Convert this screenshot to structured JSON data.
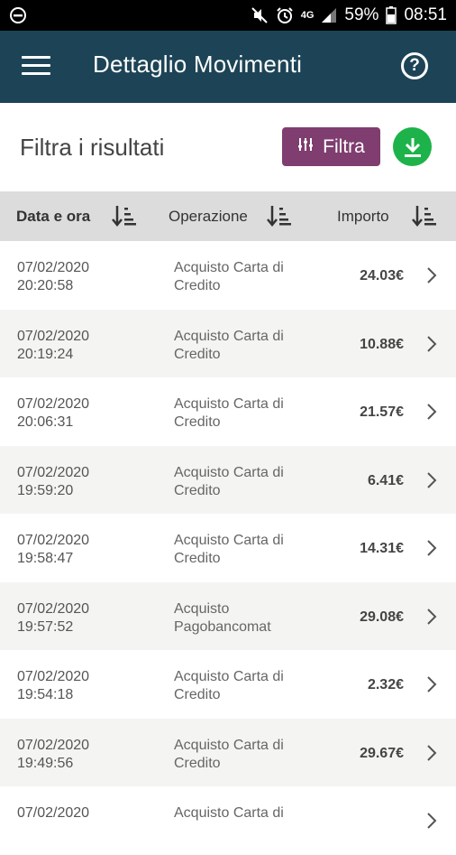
{
  "statusbar": {
    "battery": "59%",
    "time": "08:51",
    "network": "4G",
    "icons": [
      "dnd-icon",
      "mute-icon",
      "alarm-icon",
      "signal-icon",
      "battery-icon"
    ]
  },
  "appbar": {
    "title": "Dettaglio Movimenti",
    "menu_icon": "hamburger-menu-icon",
    "help_icon": "help-circle-icon",
    "help_glyph": "?"
  },
  "filter": {
    "title": "Filtra i risultati",
    "button_label": "Filtra",
    "download_icon": "download-icon"
  },
  "colors": {
    "appbar": "#1d4456",
    "filter_button": "#7f3e6f",
    "download_button": "#1db34a",
    "table_header": "#dcdcdc",
    "row_alt": "#f4f4f2"
  },
  "table": {
    "columns": [
      "Data e ora",
      "Operazione",
      "Importo"
    ],
    "rows": [
      {
        "date": "07/02/2020",
        "time": "20:20:58",
        "op1": "Acquisto Carta di",
        "op2": "Credito",
        "amount": "24.03€"
      },
      {
        "date": "07/02/2020",
        "time": "20:19:24",
        "op1": "Acquisto Carta di",
        "op2": "Credito",
        "amount": "10.88€"
      },
      {
        "date": "07/02/2020",
        "time": "20:06:31",
        "op1": "Acquisto Carta di",
        "op2": "Credito",
        "amount": "21.57€"
      },
      {
        "date": "07/02/2020",
        "time": "19:59:20",
        "op1": "Acquisto Carta di",
        "op2": "Credito",
        "amount": "6.41€"
      },
      {
        "date": "07/02/2020",
        "time": "19:58:47",
        "op1": "Acquisto Carta di",
        "op2": "Credito",
        "amount": "14.31€"
      },
      {
        "date": "07/02/2020",
        "time": "19:57:52",
        "op1": "Acquisto",
        "op2": "Pagobancomat",
        "amount": "29.08€"
      },
      {
        "date": "07/02/2020",
        "time": "19:54:18",
        "op1": "Acquisto Carta di",
        "op2": "Credito",
        "amount": "2.32€"
      },
      {
        "date": "07/02/2020",
        "time": "19:49:56",
        "op1": "Acquisto Carta di",
        "op2": "Credito",
        "amount": "29.67€"
      },
      {
        "date": "07/02/2020",
        "time": "",
        "op1": "Acquisto Carta di",
        "op2": "",
        "amount": ""
      }
    ]
  }
}
